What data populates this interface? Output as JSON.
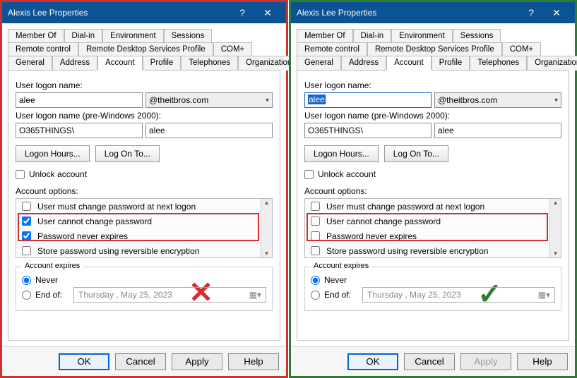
{
  "left": {
    "title": "Alexis Lee Properties",
    "tabs_row1": [
      "Member Of",
      "Dial-in",
      "Environment",
      "Sessions"
    ],
    "tabs_row2": [
      "Remote control",
      "Remote Desktop Services Profile",
      "COM+"
    ],
    "tabs_row3": [
      "General",
      "Address",
      "Account",
      "Profile",
      "Telephones",
      "Organization"
    ],
    "active_tab": "Account",
    "logon_label": "User logon name:",
    "logon_value": "alee",
    "domain": "@theitbros.com",
    "pre2000_label": "User logon name (pre-Windows 2000):",
    "pre2000_domain": "O365THINGS\\",
    "pre2000_name": "alee",
    "btn_logon_hours": "Logon Hours...",
    "btn_log_on_to": "Log On To...",
    "unlock_label": "Unlock account",
    "unlock_checked": false,
    "options_label": "Account options:",
    "options": [
      {
        "label": "User must change password at next logon",
        "checked": false
      },
      {
        "label": "User cannot change password",
        "checked": true
      },
      {
        "label": "Password never expires",
        "checked": true
      },
      {
        "label": "Store password using reversible encryption",
        "checked": false
      }
    ],
    "expires_label": "Account expires",
    "radio_never": "Never",
    "radio_endof": "End of:",
    "radio_selected": "never",
    "date_value": "Thursday ,   May    25, 2023",
    "footer": {
      "ok": "OK",
      "cancel": "Cancel",
      "apply": "Apply",
      "help": "Help"
    },
    "mark": "✕",
    "logon_selected": false
  },
  "right": {
    "title": "Alexis Lee Properties",
    "tabs_row1": [
      "Member Of",
      "Dial-in",
      "Environment",
      "Sessions"
    ],
    "tabs_row2": [
      "Remote control",
      "Remote Desktop Services Profile",
      "COM+"
    ],
    "tabs_row3": [
      "General",
      "Address",
      "Account",
      "Profile",
      "Telephones",
      "Organization"
    ],
    "active_tab": "Account",
    "logon_label": "User logon name:",
    "logon_value": "alee",
    "domain": "@theitbros.com",
    "pre2000_label": "User logon name (pre-Windows 2000):",
    "pre2000_domain": "O365THINGS\\",
    "pre2000_name": "alee",
    "btn_logon_hours": "Logon Hours...",
    "btn_log_on_to": "Log On To...",
    "unlock_label": "Unlock account",
    "unlock_checked": false,
    "options_label": "Account options:",
    "options": [
      {
        "label": "User must change password at next logon",
        "checked": false
      },
      {
        "label": "User cannot change password",
        "checked": false
      },
      {
        "label": "Password never expires",
        "checked": false
      },
      {
        "label": "Store password using reversible encryption",
        "checked": false
      }
    ],
    "expires_label": "Account expires",
    "radio_never": "Never",
    "radio_endof": "End of:",
    "radio_selected": "never",
    "date_value": "Thursday ,   May    25, 2023",
    "footer": {
      "ok": "OK",
      "cancel": "Cancel",
      "apply": "Apply",
      "help": "Help"
    },
    "mark": "✓",
    "logon_selected": true,
    "apply_disabled": true
  }
}
